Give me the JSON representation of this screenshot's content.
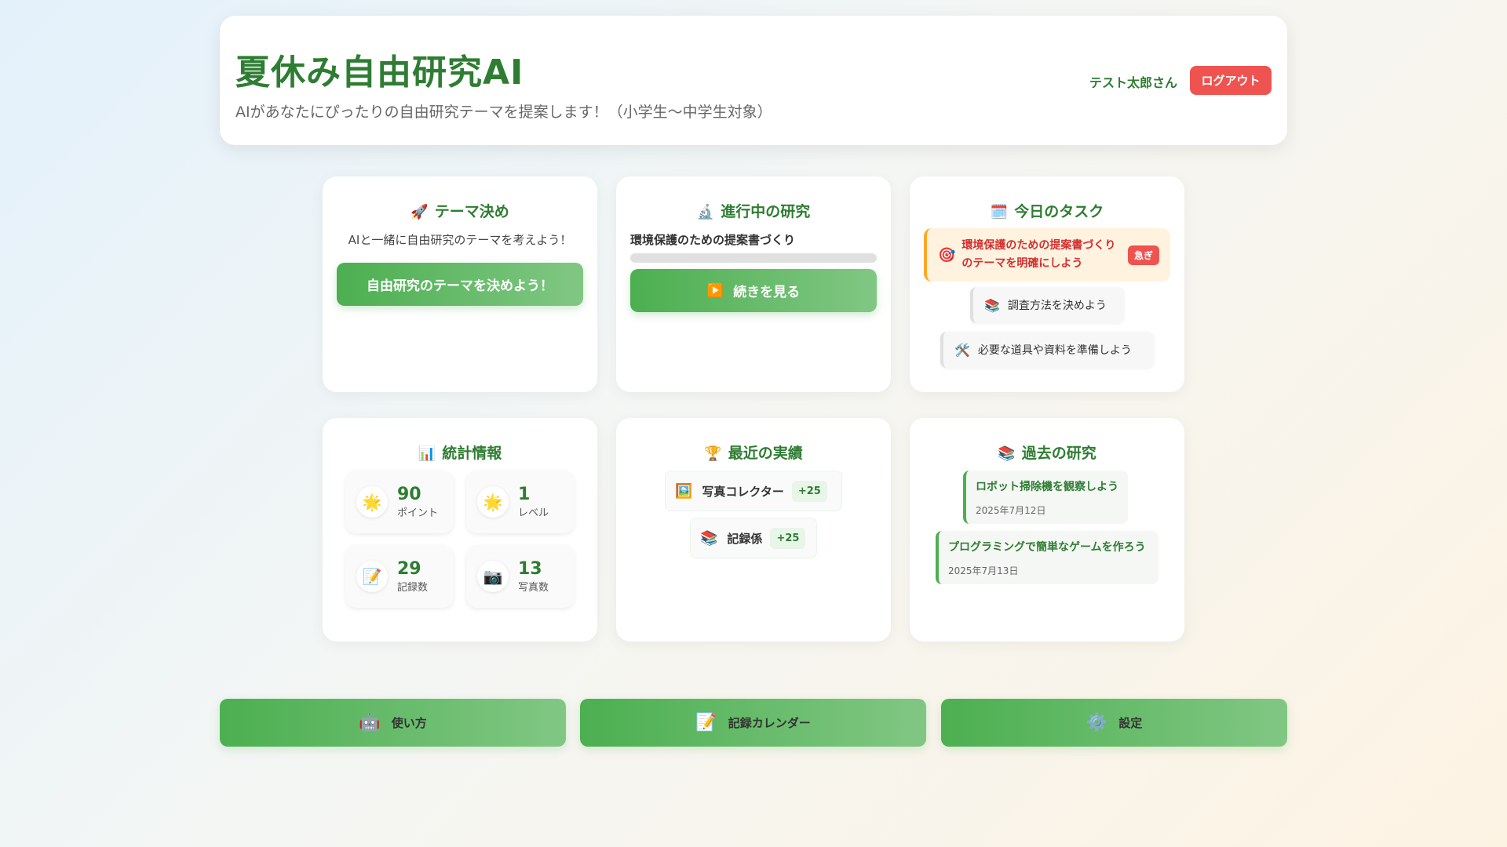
{
  "header": {
    "title": "夏休み自由研究AI",
    "subtitle": "AIがあなたにぴったりの自由研究テーマを提案します！（小学生〜中学生対象）",
    "user_name": "テスト太郎さん",
    "logout_label": "ログアウト"
  },
  "theme_card": {
    "icon": "rocket-icon",
    "title": "テーマ決め",
    "description": "AIと一緒に自由研究のテーマを考えよう！",
    "button_label": "自由研究のテーマを決めよう！"
  },
  "progress_card": {
    "icon": "microscope-icon",
    "title": "進行中の研究",
    "project_name": "環境保護のための提案書づくり",
    "progress": 0,
    "button_label": "続きを見る"
  },
  "tasks_card": {
    "icon": "calendar-icon",
    "title": "今日のタスク",
    "tasks": [
      {
        "icon": "target-icon",
        "text": "環境保護のための提案書づくりのテーマを明確にしよう",
        "badge": "急ぎ"
      },
      {
        "icon": "books-icon",
        "text": "調査方法を決めよう"
      },
      {
        "icon": "tools-icon",
        "text": "必要な道具や資料を準備しよう"
      }
    ]
  },
  "stats_card": {
    "icon": "bar-chart-icon",
    "title": "統計情報",
    "stats": [
      {
        "icon": "sun-icon",
        "value": "90",
        "label": "ポイント"
      },
      {
        "icon": "sun-icon",
        "value": "1",
        "label": "レベル"
      },
      {
        "icon": "memo-icon",
        "value": "29",
        "label": "記録数"
      },
      {
        "icon": "camera-icon",
        "value": "13",
        "label": "写真数"
      }
    ]
  },
  "achievements_card": {
    "icon": "trophy-icon",
    "title": "最近の実績",
    "items": [
      {
        "icon": "picture-icon",
        "label": "写真コレクター",
        "points": "+25"
      },
      {
        "icon": "books-icon",
        "label": "記録係",
        "points": "+25"
      }
    ]
  },
  "past_card": {
    "icon": "books-icon",
    "title": "過去の研究",
    "items": [
      {
        "title": "ロボット掃除機を観察しよう",
        "date": "2025年7月12日"
      },
      {
        "title": "プログラミングで簡単なゲームを作ろう",
        "date": "2025年7月13日"
      }
    ]
  },
  "bottom_nav": [
    {
      "icon": "robot-icon",
      "label": "使い方"
    },
    {
      "icon": "memo-icon",
      "label": "記録カレンダー"
    },
    {
      "icon": "gear-icon",
      "label": "設定"
    }
  ],
  "colors": {
    "primary_green": "#4caf50",
    "title_green": "#2e7d32",
    "danger_red": "#ef5350",
    "urgent_bg": "#fff3e0"
  }
}
